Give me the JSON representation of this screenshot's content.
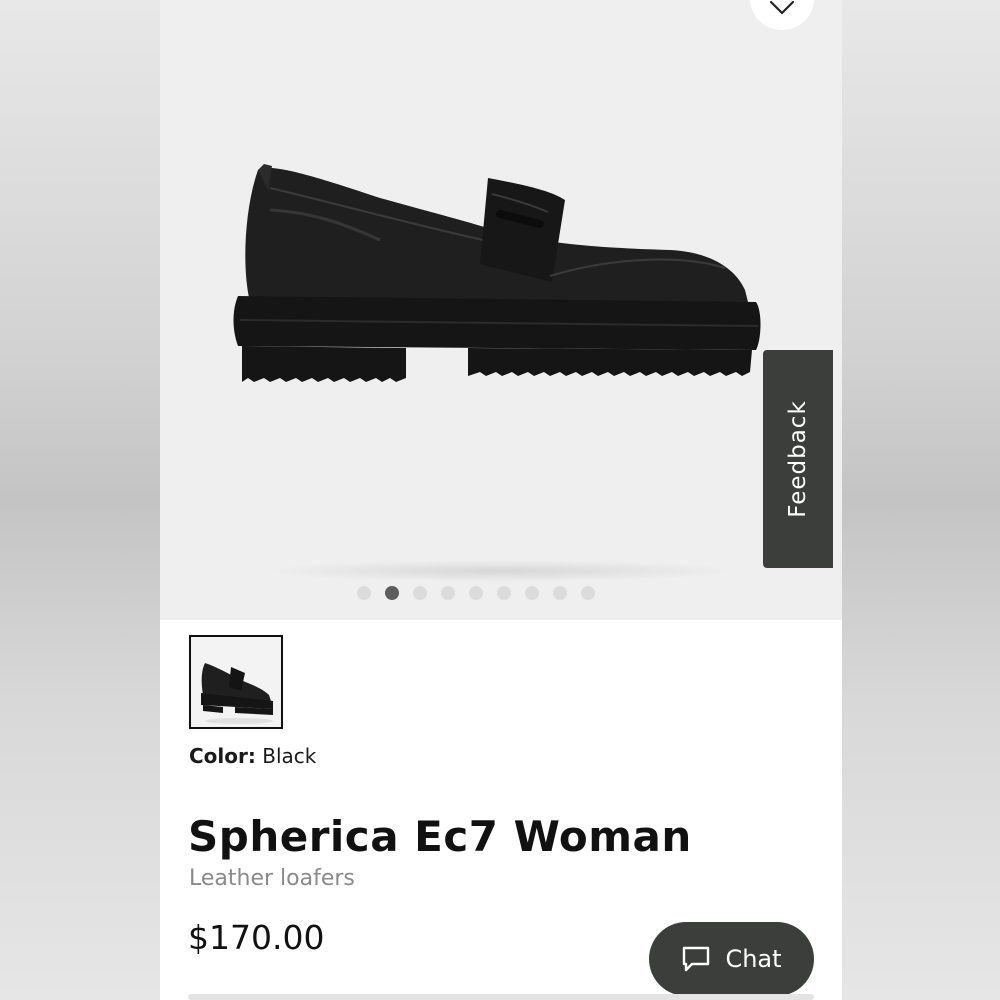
{
  "product": {
    "title": "Spherica Ec7 Woman",
    "subtitle": "Leather loafers",
    "price": "$170.00",
    "color_label": "Color:",
    "color_value": "Black"
  },
  "gallery": {
    "total_images": 9,
    "active_index": 1
  },
  "feedback": {
    "label": "Feedback"
  },
  "chat": {
    "label": "Chat"
  },
  "icons": {
    "wishlist": "heart-icon",
    "chat": "chat-bubble-icon"
  },
  "colors": {
    "dark_button": "#3c3e3b",
    "hero_background": "#efefef",
    "active_dot": "#5d5d5d",
    "inactive_dot": "#dcdcdc",
    "subtitle_text": "#8a8a8a"
  }
}
